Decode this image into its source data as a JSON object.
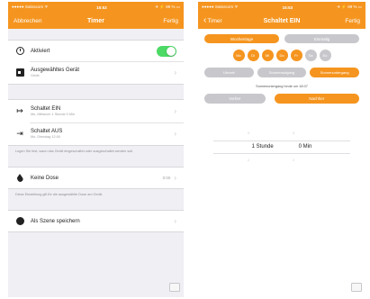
{
  "colors": {
    "accent": "#f5951f",
    "toggle_on": "#4cd964",
    "inactive": "#c8c8cc"
  },
  "screen1": {
    "status": {
      "carrier": "●●●●● Swisscom ᯤ",
      "time": "15:53",
      "battery": "✈ ⚡ 89 %  ▭"
    },
    "nav": {
      "back_label": "Abbrechen",
      "title": "Timer",
      "done_label": "Fertig"
    },
    "rows": {
      "active": {
        "label": "Aktiviert",
        "icon": "clock-icon"
      },
      "device": {
        "label": "Ausgewähltes Gerät",
        "sub": "Gerät",
        "icon": "calendar-icon"
      },
      "switch_on": {
        "label": "Schaltet EIN",
        "sub": "Mo, Mittwoch 1 Stunde 0 Min",
        "icon": "arrow-right-bar-icon"
      },
      "switch_off": {
        "label": "Schaltet AUS",
        "sub": "Mo, Dienstag 12:00",
        "icon": "arrow-left-bar-icon"
      },
      "none": {
        "label": "Keine Dose",
        "value": "0:00",
        "icon": "drop-icon"
      },
      "save": {
        "label": "Als Szene speichern",
        "icon": "dot-icon"
      }
    },
    "notes": {
      "n1": "Legen Sie fest, wann das Gerät eingeschaltet oder ausgeschaltet werden soll.",
      "n2": "Diese Einstellung gilt für die ausgewählte Dose am Gerät."
    }
  },
  "screen2": {
    "status": {
      "carrier": "●●●●● Swisscom ᯤ",
      "time": "15:53",
      "battery": "✈ ⚡ 89 %  ▭"
    },
    "nav": {
      "back_label": "Timer",
      "title": "Schaltet EIN",
      "done_label": "Fertig"
    },
    "mode_tabs": [
      "Wochentage",
      "Einmalig"
    ],
    "days": [
      {
        "label": "Mo",
        "on": true
      },
      {
        "label": "Di",
        "on": true
      },
      {
        "label": "Mi",
        "on": true
      },
      {
        "label": "Do",
        "on": true
      },
      {
        "label": "Fr",
        "on": true
      },
      {
        "label": "Sa",
        "on": false
      },
      {
        "label": "So",
        "on": false
      }
    ],
    "time_tabs": [
      "Uhrzeit",
      "Sonnenaufgang",
      "Sonnenuntergang"
    ],
    "hint": "Sonnenuntergang heute um 18:07",
    "offset_tabs": [
      "Vorher",
      "Nachher"
    ],
    "picker": {
      "hours_value": "1 Stunde",
      "minutes_value": "0 Min",
      "faint_above": "0",
      "faint_below": "2"
    }
  }
}
